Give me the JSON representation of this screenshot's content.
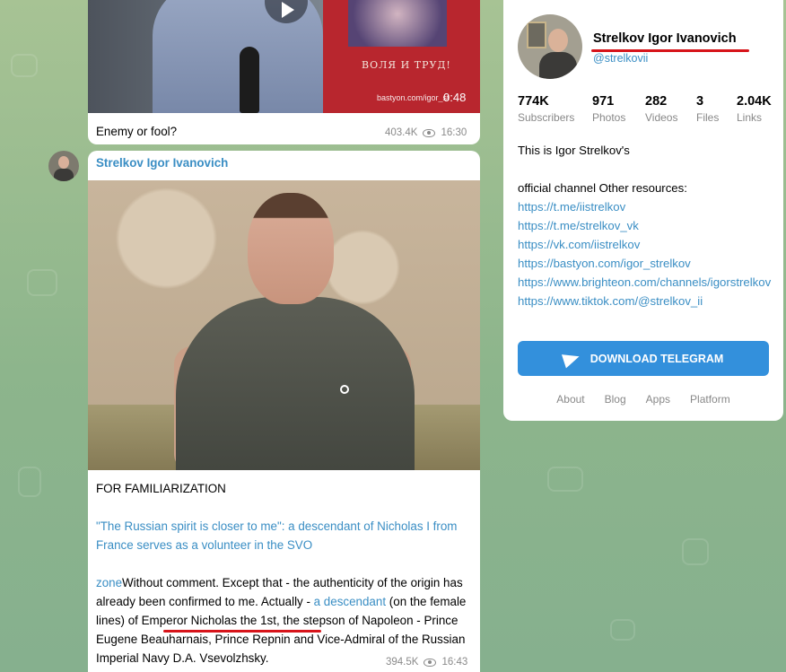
{
  "post_top": {
    "thumbnail": {
      "flag_text": "ВОЛЯ И ТРУД!",
      "watermark": "bastyon.com/igor_st",
      "duration": "0:48"
    },
    "caption": "Enemy or fool?",
    "views": "403.4K",
    "time": "16:30"
  },
  "post_main": {
    "sender": "Strelkov Igor Ivanovich",
    "heading": "FOR FAMILIARIZATION",
    "link_title": "\"The Russian spirit is closer to me\": a descendant of Nicholas I from France serves as a volunteer in the SVO",
    "body": {
      "prefix_link": "zone",
      "text_1": "Without comment. Except that - the authenticity of the origin has already been confirmed to me. Actually - ",
      "inline_link": "a descendant",
      "text_2": " (on the female lines) of Emperor Nicholas the 1st, the stepson of Napoleon - Prince Eugene Beauharnais, Prince Repnin and Vice-Admiral of the Russian Imperial Navy D.A. Vsevolzhsky."
    },
    "views": "394.5K",
    "time": "16:43"
  },
  "channel": {
    "name": "Strelkov Igor Ivanovich",
    "handle": "@strelkovii",
    "stats": [
      {
        "value": "774K",
        "label": "Subscribers"
      },
      {
        "value": "971",
        "label": "Photos"
      },
      {
        "value": "282",
        "label": "Videos"
      },
      {
        "value": "3",
        "label": "Files"
      },
      {
        "value": "2.04K",
        "label": "Links"
      }
    ],
    "description": {
      "line_1": "This is Igor Strelkov's",
      "line_2": "official channel Other resources:",
      "links": [
        "https://t.me/iistrelkov",
        "https://t.me/strelkov_vk",
        "https://vk.com/iistrelkov",
        "https://bastyon.com/igor_strelkov",
        "https://www.brighteon.com/channels/igorstrelkov",
        "https://www.tiktok.com/@strelkov_ii"
      ]
    },
    "download_button": "DOWNLOAD TELEGRAM",
    "footer_links": [
      "About",
      "Blog",
      "Apps",
      "Platform"
    ]
  },
  "colors": {
    "accent": "#3390dc",
    "link": "#3a8ec4",
    "annotation_underline": "#d7141a"
  },
  "icons": [
    "play-icon",
    "eye-icon",
    "telegram-plane-icon"
  ]
}
